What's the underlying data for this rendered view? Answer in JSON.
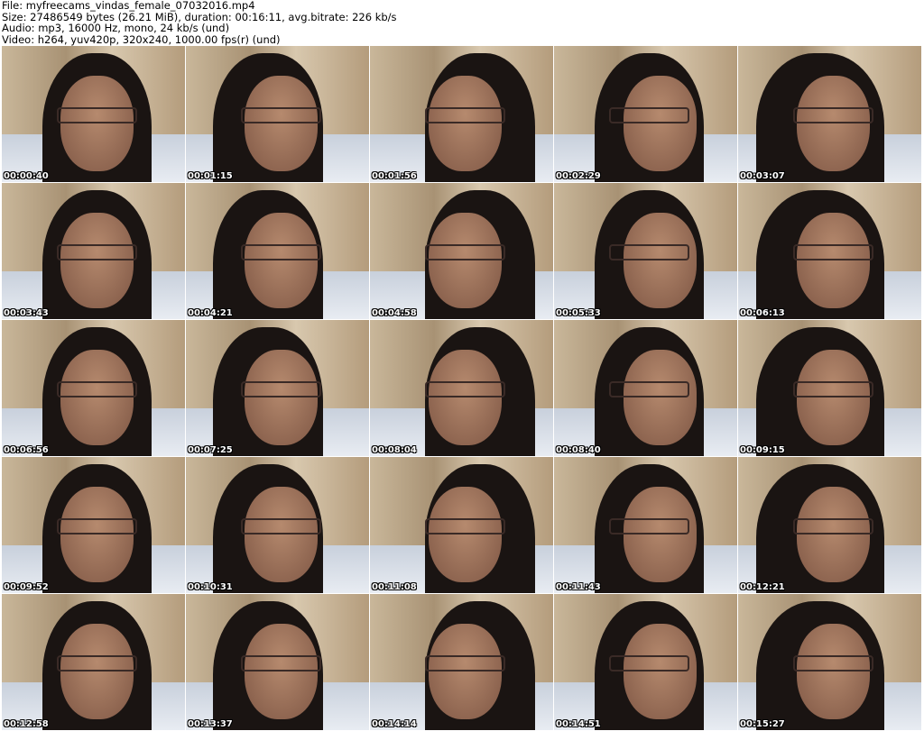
{
  "header": {
    "file": "File: myfreecams_vindas_female_07032016.mp4",
    "size": "Size: 27486549 bytes (26.21 MiB), duration: 00:16:11, avg.bitrate: 226 kb/s",
    "audio": "Audio: mp3, 16000 Hz, mono, 24 kb/s (und)",
    "video": "Video: h264, yuv420p, 320x240, 1000.00 fps(r) (und)"
  },
  "thumbnails": [
    "00:00:40",
    "00:01:15",
    "00:01:56",
    "00:02:29",
    "00:03:07",
    "00:03:43",
    "00:04:21",
    "00:04:58",
    "00:05:33",
    "00:06:13",
    "00:06:56",
    "00:07:25",
    "00:08:04",
    "00:08:40",
    "00:09:15",
    "00:09:52",
    "00:10:31",
    "00:11:08",
    "00:11:43",
    "00:12:21",
    "00:12:58",
    "00:13:37",
    "00:14:14",
    "00:14:51",
    "00:15:27"
  ]
}
